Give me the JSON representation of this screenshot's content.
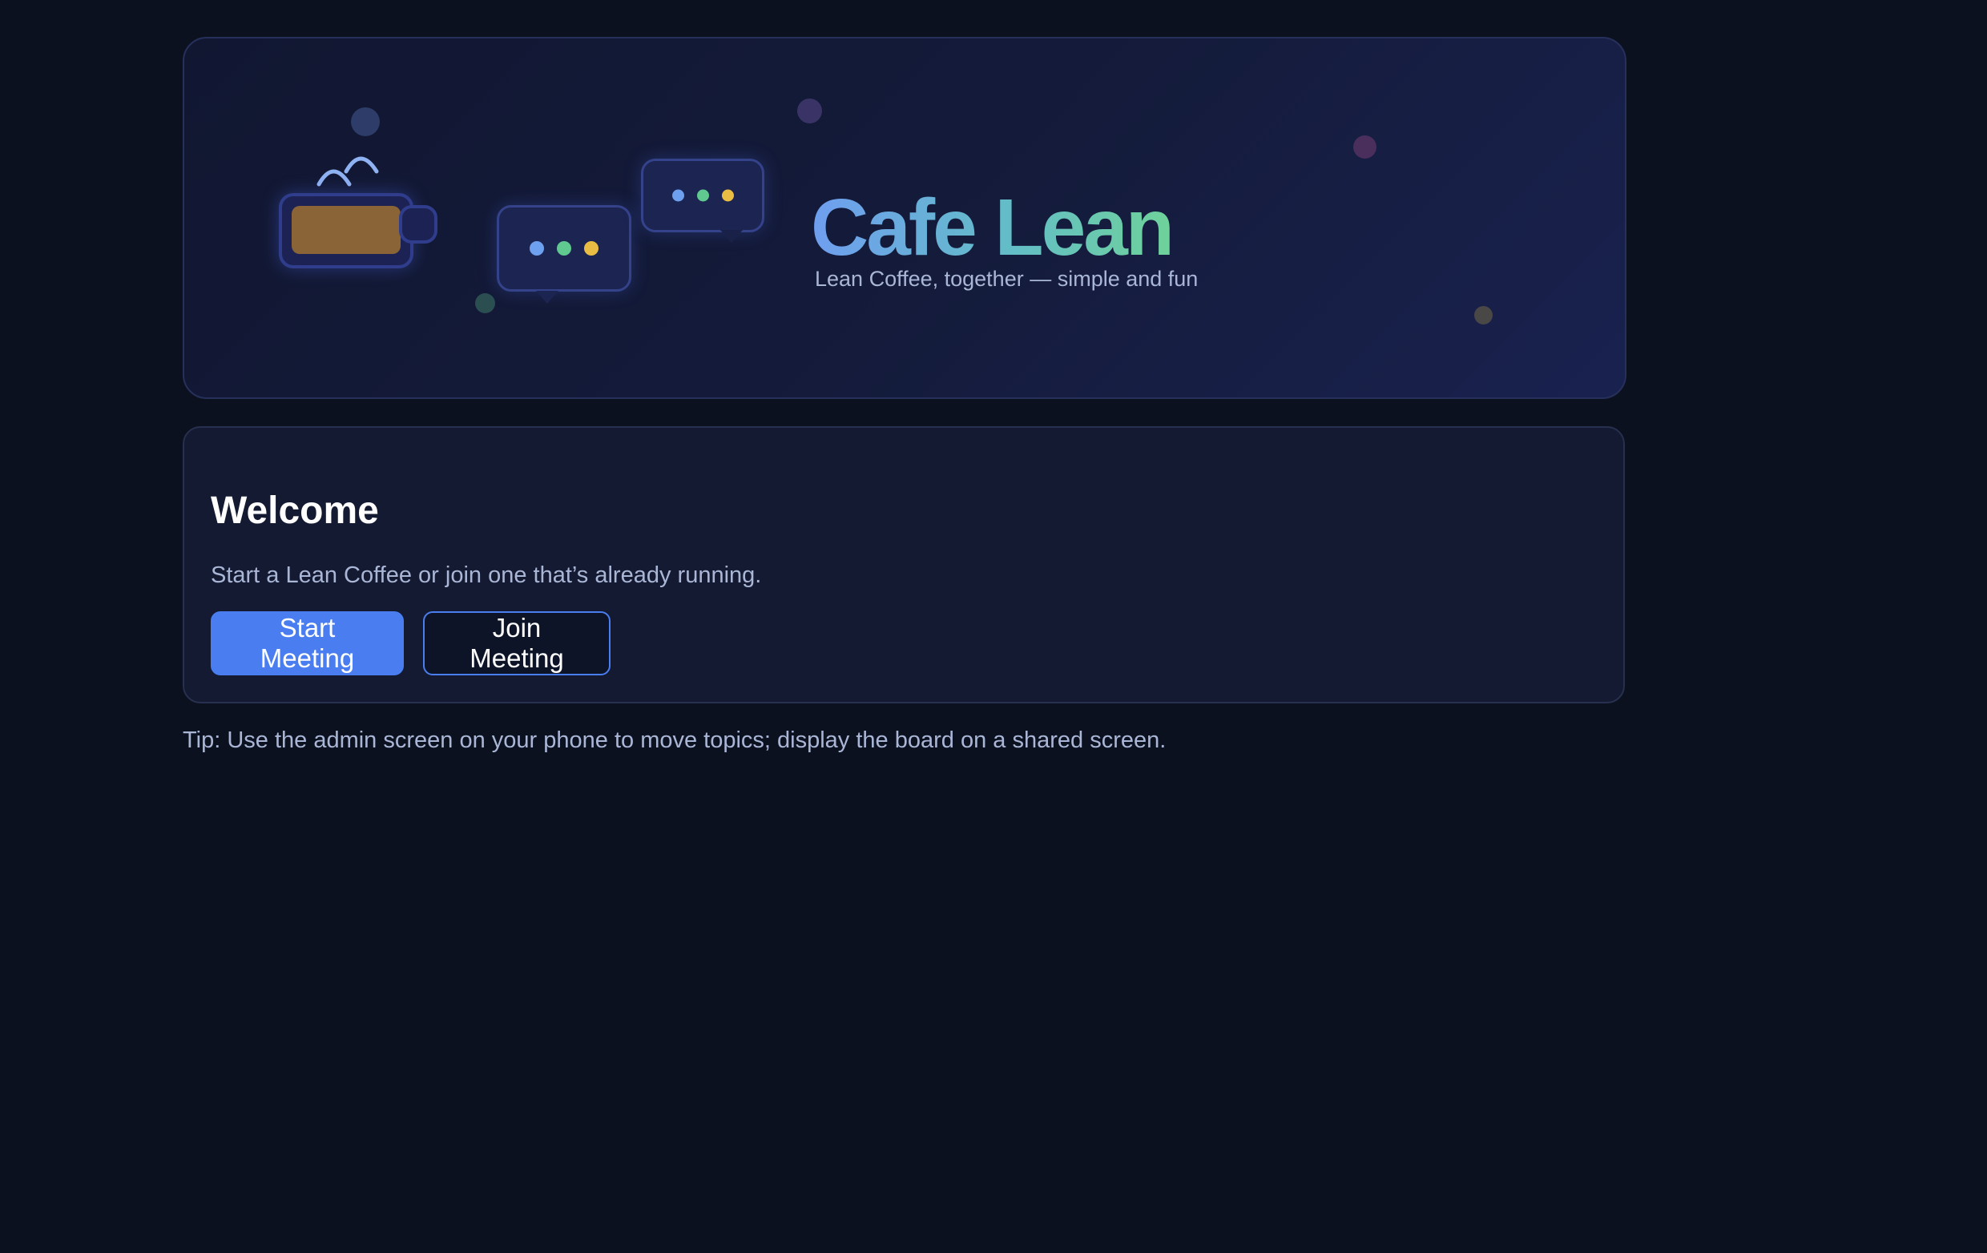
{
  "hero": {
    "title": "Cafe Lean",
    "subtitle": "Lean Coffee, together — simple and fun",
    "illustration": {
      "icons": [
        "coffee-mug-icon",
        "steam-icon",
        "chat-bubble-icon",
        "chat-bubble-icon"
      ],
      "dot_colors": [
        "#6ea0f0",
        "#5fc98f",
        "#e9bd43"
      ],
      "coffee_color": "#8a6336"
    }
  },
  "welcome": {
    "title": "Welcome",
    "text": "Start a Lean Coffee or join one that’s already running.",
    "start_button": "Start Meeting",
    "join_button": "Join Meeting"
  },
  "tip": "Tip: Use the admin screen on your phone to move topics; display the board on a shared screen.",
  "colors": {
    "background": "#0c1120",
    "accent": "#4a7ef0",
    "title_gradient": [
      "#6f9ef0",
      "#63bdc7",
      "#6fd29a"
    ]
  }
}
